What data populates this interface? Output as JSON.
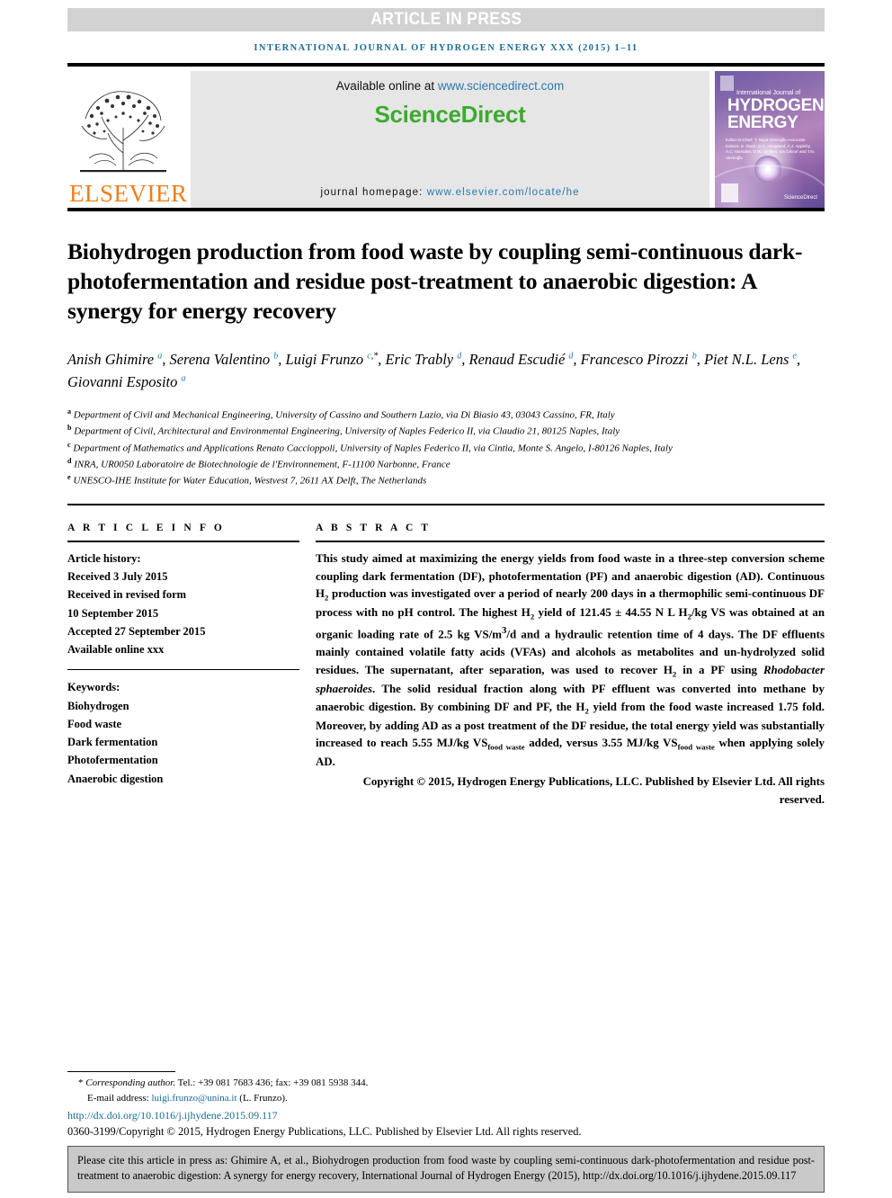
{
  "banner": {
    "article_in_press": "ARTICLE IN PRESS",
    "running_head": "International Journal of Hydrogen Energy xxx (2015) 1–11"
  },
  "masthead": {
    "publisher_name": "ELSEVIER",
    "available_prefix": "Available online at ",
    "available_url": "www.sciencedirect.com",
    "sciencedirect_logo": "ScienceDirect",
    "homepage_prefix": "journal homepage: ",
    "homepage_url": "www.elsevier.com/locate/he",
    "cover": {
      "small_line": "International Journal of",
      "big_line_1": "HYDROGEN",
      "big_line_2": "ENERGY",
      "editors": "Editor-in-Chief: T. Nejat Veziroğlu\nAssociate Editors: S. Dunn, D.C. Hoagland, A.J. Appleby, A.C. Marsden, D.W. Stellers, Ion Dincer and T.N. Veziroğlu",
      "sciencedirect_mark": "ScienceDirect"
    }
  },
  "article": {
    "title": "Biohydrogen production from food waste by coupling semi-continuous dark-photofermentation and residue post-treatment to anaerobic digestion: A synergy for energy recovery",
    "authors": [
      {
        "name": "Anish Ghimire",
        "marks": "a",
        "star": false
      },
      {
        "name": "Serena Valentino",
        "marks": "b",
        "star": false
      },
      {
        "name": "Luigi Frunzo",
        "marks": "c",
        "star": true
      },
      {
        "name": "Eric Trably",
        "marks": "d",
        "star": false
      },
      {
        "name": "Renaud Escudié",
        "marks": "d",
        "star": false
      },
      {
        "name": "Francesco Pirozzi",
        "marks": "b",
        "star": false
      },
      {
        "name": "Piet N.L. Lens",
        "marks": "e",
        "star": false
      },
      {
        "name": "Giovanni Esposito",
        "marks": "a",
        "star": false
      }
    ],
    "affiliations": [
      {
        "mark": "a",
        "text": "Department of Civil and Mechanical Engineering, University of Cassino and Southern Lazio, via Di Biasio 43, 03043 Cassino, FR, Italy"
      },
      {
        "mark": "b",
        "text": "Department of Civil, Architectural and Environmental Engineering, University of Naples Federico II, via Claudio 21, 80125 Naples, Italy"
      },
      {
        "mark": "c",
        "text": "Department of Mathematics and Applications Renato Caccioppoli, University of Naples Federico II, via Cintia, Monte S. Angelo, I-80126 Naples, Italy"
      },
      {
        "mark": "d",
        "text": "INRA, UR0050 Laboratoire de Biotechnologie de l'Environnement, F-11100 Narbonne, France"
      },
      {
        "mark": "e",
        "text": "UNESCO-IHE Institute for Water Education, Westvest 7, 2611 AX Delft, The Netherlands"
      }
    ]
  },
  "article_info": {
    "heading": "A R T I C L E   I N F O",
    "history_label": "Article history:",
    "history": [
      "Received 3 July 2015",
      "Received in revised form",
      "10 September 2015",
      "Accepted 27 September 2015",
      "Available online xxx"
    ],
    "keywords_label": "Keywords:",
    "keywords": [
      "Biohydrogen",
      "Food waste",
      "Dark fermentation",
      "Photofermentation",
      "Anaerobic digestion"
    ]
  },
  "abstract": {
    "heading": "A B S T R A C T",
    "part_1": "This study aimed at maximizing the energy yields from food waste in a three-step conversion scheme coupling dark fermentation (DF), photofermentation (PF) and anaerobic digestion (AD). Continuous H",
    "sub_1": "2",
    "part_2": " production was investigated over a period of nearly 200 days in a thermophilic semi-continuous DF process with no pH control. The highest H",
    "sub_2": "2",
    "part_3": " yield of 121.45 ± 44.55 N L H",
    "sub_3": "2",
    "part_4": "/kg VS was obtained at an organic loading rate of 2.5 kg VS/m",
    "sup_4": "3",
    "part_5": "/d and a hydraulic retention time of 4 days. The DF effluents mainly contained volatile fatty acids (VFAs) and alcohols as metabolites and un-hydrolyzed solid residues. The supernatant, after separation, was used to recover H",
    "sub_5": "2",
    "part_6": " in a PF using ",
    "italic_1": "Rhodobacter sphaeroides",
    "part_7": ". The solid residual fraction along with PF effluent was converted into methane by anaerobic digestion. By combining DF and PF, the H",
    "sub_6": "2",
    "part_8": " yield from the food waste increased 1.75 fold. Moreover, by adding AD as a post treatment of the DF residue, the total energy yield was substantially increased to reach 5.55 MJ/kg VS",
    "sub_7": "food waste",
    "part_9": " added, versus 3.55 MJ/kg VS",
    "sub_8": "food waste",
    "part_10": " when applying solely AD.",
    "copyright": "Copyright © 2015, Hydrogen Energy Publications, LLC. Published by Elsevier Ltd. All rights reserved."
  },
  "footer": {
    "corresponding_label": "Corresponding author.",
    "corresponding_contact": " Tel.: +39 081 7683 436; fax: +39 081 5938 344.",
    "email_label": "E-mail address: ",
    "email": "luigi.frunzo@unina.it",
    "email_owner": " (L. Frunzo).",
    "doi_url": "http://dx.doi.org/10.1016/j.ijhydene.2015.09.117",
    "issn_copyright": "0360-3199/Copyright © 2015, Hydrogen Energy Publications, LLC. Published by Elsevier Ltd. All rights reserved."
  },
  "cite_box": {
    "text": "Please cite this article in press as: Ghimire A, et al., Biohydrogen production from food waste by coupling semi-continuous dark-photofermentation and residue post-treatment to anaerobic digestion: A synergy for energy recovery, International Journal of Hydrogen Energy (2015), http://dx.doi.org/10.1016/j.ijhydene.2015.09.117"
  }
}
